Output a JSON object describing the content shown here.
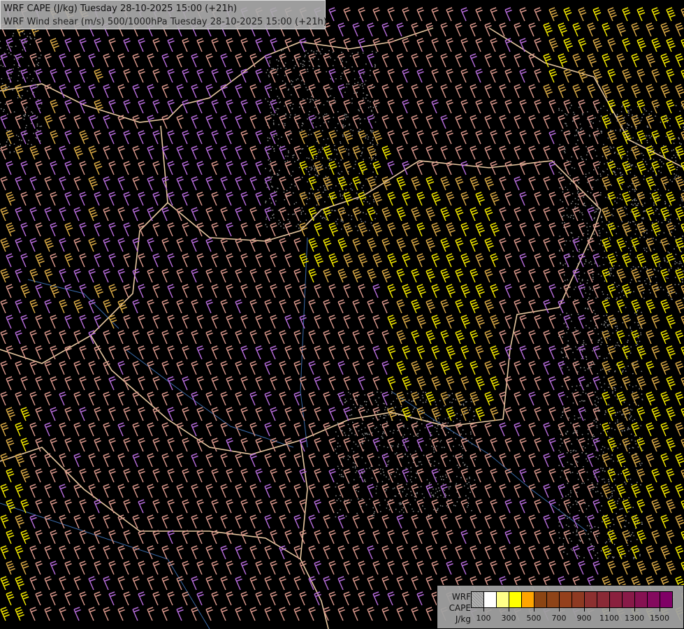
{
  "titles": {
    "line1": "WRF CAPE (J/kg) Tuesday 28-10-2025 15:00 (+21h)",
    "line2": "WRF Wind shear (m/s) 500/1000hPa Tuesday 28-10-2025 15:00 (+21h)"
  },
  "legend": {
    "label_lines": [
      "WRF",
      "CAPE",
      "J/kg"
    ],
    "colors": [
      "#9a9a9a",
      "#ffffff",
      "#ffff88",
      "#ffff00",
      "#ffa500",
      "#8b4513",
      "#8e4418",
      "#94401c",
      "#8e3a22",
      "#8c3030",
      "#8a2a36",
      "#8a203e",
      "#881a48",
      "#861252",
      "#840a5e",
      "#800066"
    ],
    "ticks": [
      "100",
      "300",
      "500",
      "700",
      "900",
      "1100",
      "1300",
      "1500"
    ]
  },
  "barb_colors": {
    "pink": "#d9968a",
    "purple": "#b46ad8",
    "yellow": "#f2e600",
    "orange": "#d8a845",
    "border": "#e8c8a0",
    "river": "#3a6aa8"
  },
  "icons": {
    "barb": "wind-barb-icon"
  }
}
